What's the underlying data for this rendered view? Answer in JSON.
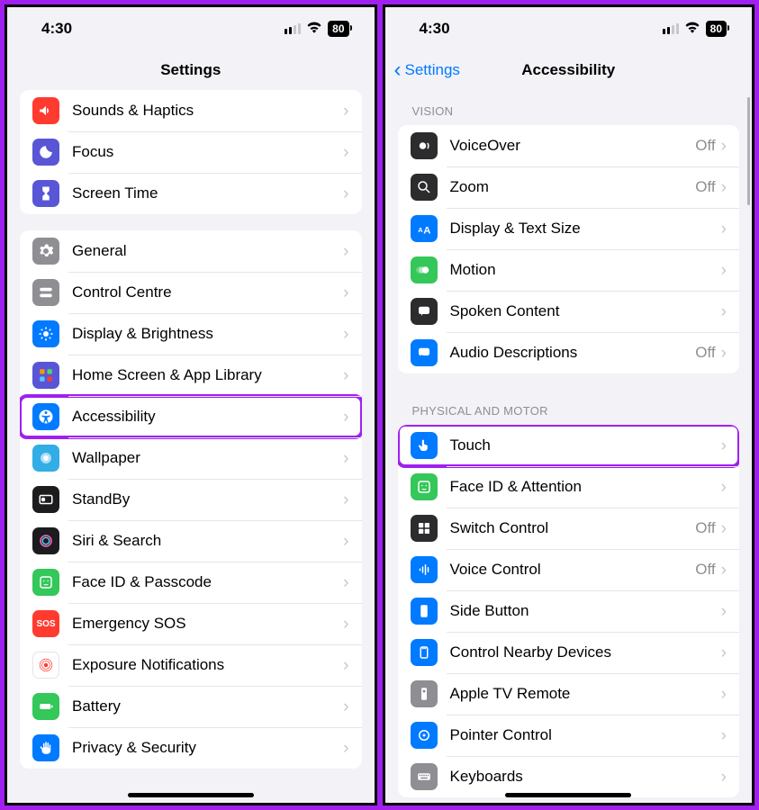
{
  "status": {
    "time": "4:30",
    "battery": "80"
  },
  "screen1": {
    "title": "Settings",
    "groups": [
      {
        "rows": [
          {
            "label": "Sounds & Haptics"
          },
          {
            "label": "Focus"
          },
          {
            "label": "Screen Time"
          }
        ]
      },
      {
        "rows": [
          {
            "label": "General"
          },
          {
            "label": "Control Centre"
          },
          {
            "label": "Display & Brightness"
          },
          {
            "label": "Home Screen & App Library"
          },
          {
            "label": "Accessibility",
            "highlight": true
          },
          {
            "label": "Wallpaper"
          },
          {
            "label": "StandBy"
          },
          {
            "label": "Siri & Search"
          },
          {
            "label": "Face ID & Passcode"
          },
          {
            "label": "Emergency SOS"
          },
          {
            "label": "Exposure Notifications"
          },
          {
            "label": "Battery"
          },
          {
            "label": "Privacy & Security"
          }
        ]
      }
    ]
  },
  "screen2": {
    "back": "Settings",
    "title": "Accessibility",
    "sections": [
      {
        "header": "VISION",
        "rows": [
          {
            "label": "VoiceOver",
            "value": "Off"
          },
          {
            "label": "Zoom",
            "value": "Off"
          },
          {
            "label": "Display & Text Size"
          },
          {
            "label": "Motion"
          },
          {
            "label": "Spoken Content"
          },
          {
            "label": "Audio Descriptions",
            "value": "Off"
          }
        ]
      },
      {
        "header": "PHYSICAL AND MOTOR",
        "rows": [
          {
            "label": "Touch",
            "highlight": true
          },
          {
            "label": "Face ID & Attention"
          },
          {
            "label": "Switch Control",
            "value": "Off"
          },
          {
            "label": "Voice Control",
            "value": "Off"
          },
          {
            "label": "Side Button"
          },
          {
            "label": "Control Nearby Devices"
          },
          {
            "label": "Apple TV Remote"
          },
          {
            "label": "Pointer Control"
          },
          {
            "label": "Keyboards"
          }
        ]
      }
    ]
  }
}
